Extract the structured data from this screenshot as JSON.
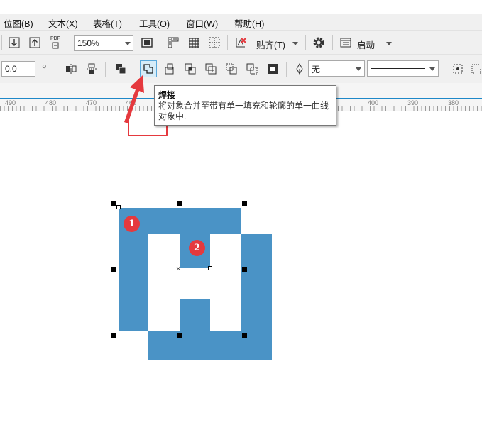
{
  "menu": [
    {
      "id": "bitmap",
      "label": "位图(B)"
    },
    {
      "id": "text",
      "label": "文本(X)"
    },
    {
      "id": "table",
      "label": "表格(T)"
    },
    {
      "id": "tools",
      "label": "工具(O)"
    },
    {
      "id": "window",
      "label": "窗口(W)"
    },
    {
      "id": "help",
      "label": "帮助(H)"
    }
  ],
  "toolbar1": {
    "pdf_label": "PDF",
    "zoom_value": "150%",
    "snap_label": "贴齐(T)",
    "launch_label": "启动"
  },
  "toolbar2": {
    "angle_value": "0.0",
    "fill_value": "无"
  },
  "ruler": {
    "labels": [
      "490",
      "480",
      "470",
      "460",
      "400",
      "390",
      "380"
    ]
  },
  "tooltip": {
    "title": "焊接",
    "description": "将对象合并至带有单一填充和轮廓的单一曲线对象中."
  },
  "canvas": {
    "badge1": "1",
    "badge2": "2",
    "shape_color": "#4a93c6",
    "highlight_color": "#e5393e"
  }
}
